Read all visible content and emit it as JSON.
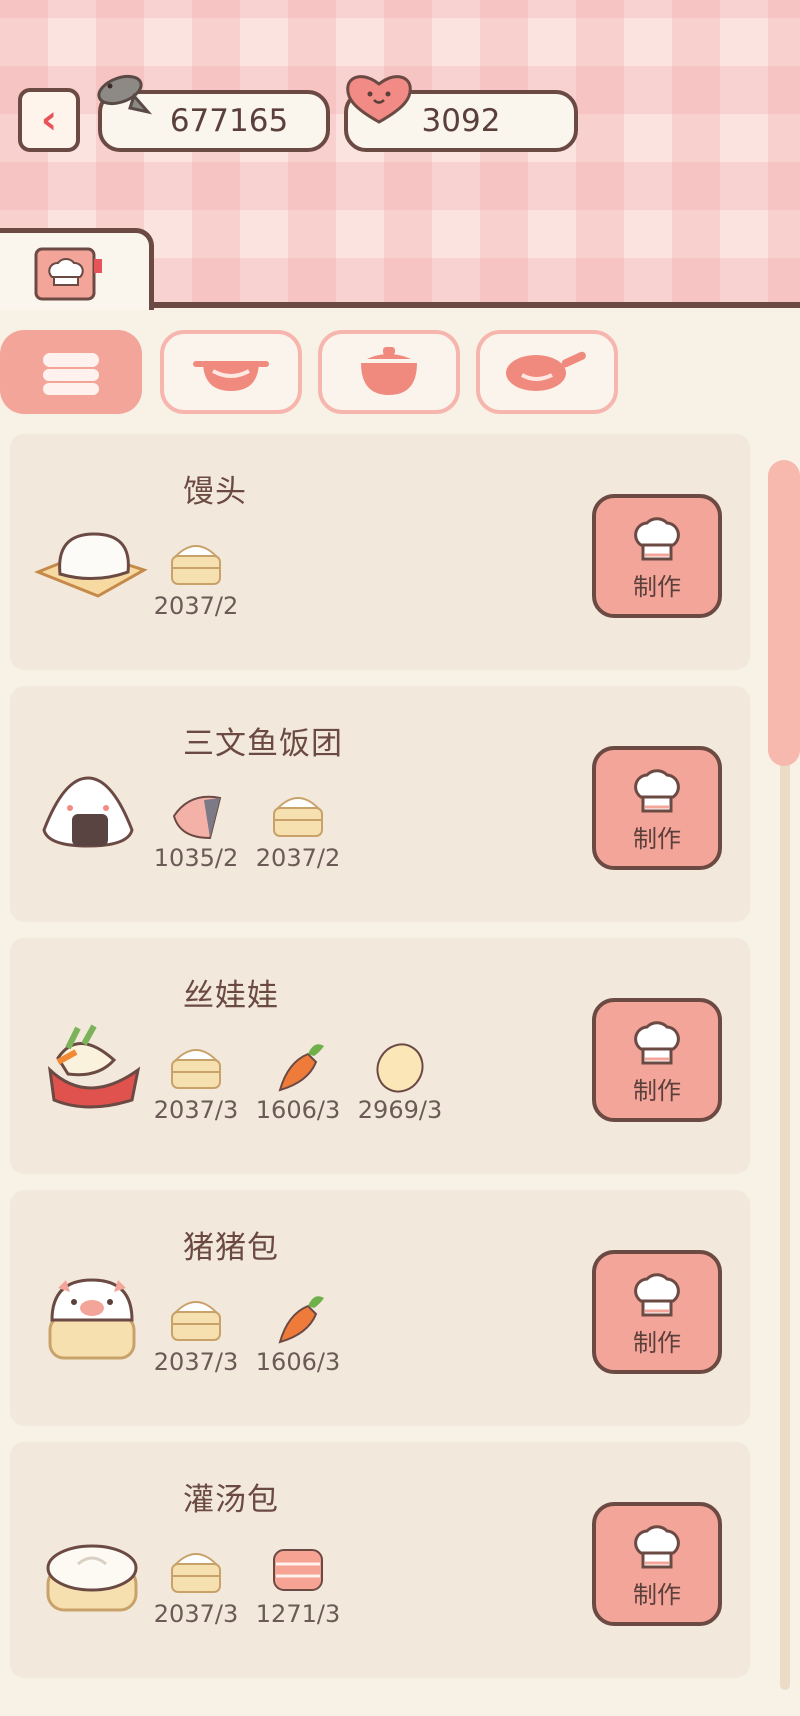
{
  "header": {
    "fish_count": "677165",
    "heart_count": "3092"
  },
  "recipes": [
    {
      "name": "馒头",
      "ingredients": [
        {
          "icon": "bun-basket-icon",
          "qty": "2037/2"
        }
      ]
    },
    {
      "name": "三文鱼饭团",
      "ingredients": [
        {
          "icon": "salmon-icon",
          "qty": "1035/2"
        },
        {
          "icon": "bun-basket-icon",
          "qty": "2037/2"
        }
      ]
    },
    {
      "name": "丝娃娃",
      "ingredients": [
        {
          "icon": "bun-basket-icon",
          "qty": "2037/3"
        },
        {
          "icon": "carrot-icon",
          "qty": "1606/3"
        },
        {
          "icon": "egg-icon",
          "qty": "2969/3"
        }
      ]
    },
    {
      "name": "猪猪包",
      "ingredients": [
        {
          "icon": "bun-basket-icon",
          "qty": "2037/3"
        },
        {
          "icon": "carrot-icon",
          "qty": "1606/3"
        }
      ]
    },
    {
      "name": "灌汤包",
      "ingredients": [
        {
          "icon": "bun-basket-icon",
          "qty": "2037/3"
        },
        {
          "icon": "meat-icon",
          "qty": "1271/3"
        }
      ]
    }
  ],
  "make_label": "制作",
  "colors": {
    "accent": "#f4a59a",
    "outline": "#6b4a44",
    "card": "#f2e9dc",
    "back_arrow": "#e6545a"
  }
}
